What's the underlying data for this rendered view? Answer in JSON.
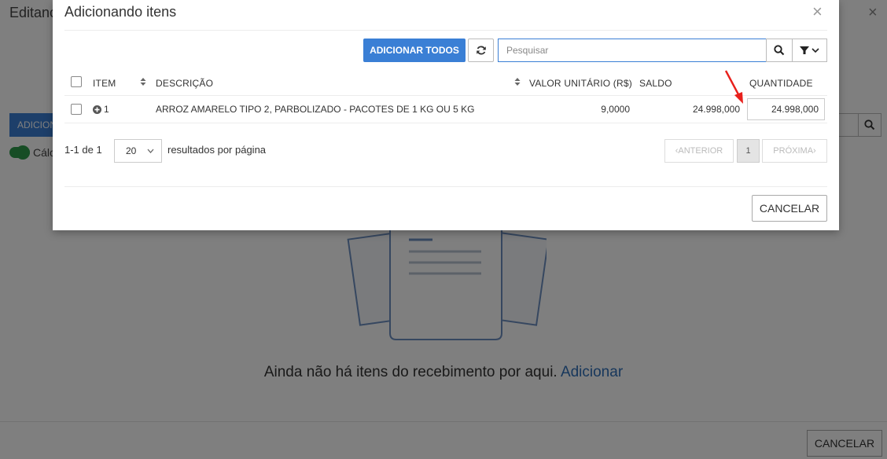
{
  "background": {
    "title": "Editanc",
    "add_button_label": "ADICION",
    "toggle_label": "Cálc",
    "empty_text": "Ainda não há itens do recebimento por aqui.",
    "empty_link": "Adicionar",
    "cancel_label": "CANCELAR"
  },
  "modal": {
    "title": "Adicionando itens",
    "close_glyph": "×",
    "toolbar": {
      "add_all_label": "ADICIONAR TODOS",
      "search_placeholder": "Pesquisar"
    },
    "table": {
      "headers": {
        "item": "ITEM",
        "descricao": "DESCRIÇÃO",
        "valor": "VALOR UNITÁRIO (R$)",
        "saldo": "SALDO",
        "quantidade": "QUANTIDADE"
      },
      "rows": [
        {
          "item": "1",
          "descricao": "ARROZ AMARELO TIPO 2, PARBOLIZADO - PACOTES DE 1 KG OU 5 KG",
          "valor": "9,0000",
          "saldo": "24.998,000",
          "quantidade": "24.998,000"
        }
      ]
    },
    "pagination": {
      "range": "1-1 de 1",
      "per_page": "20",
      "per_page_label": "resultados por página",
      "prev_label": "ANTERIOR",
      "current_page": "1",
      "next_label": "PRÓXIMA"
    },
    "cancel_label": "CANCELAR"
  },
  "colors": {
    "primary": "#3a7fd5",
    "annotation_arrow": "#e8201c",
    "toggle_on": "#2e9a4a"
  }
}
